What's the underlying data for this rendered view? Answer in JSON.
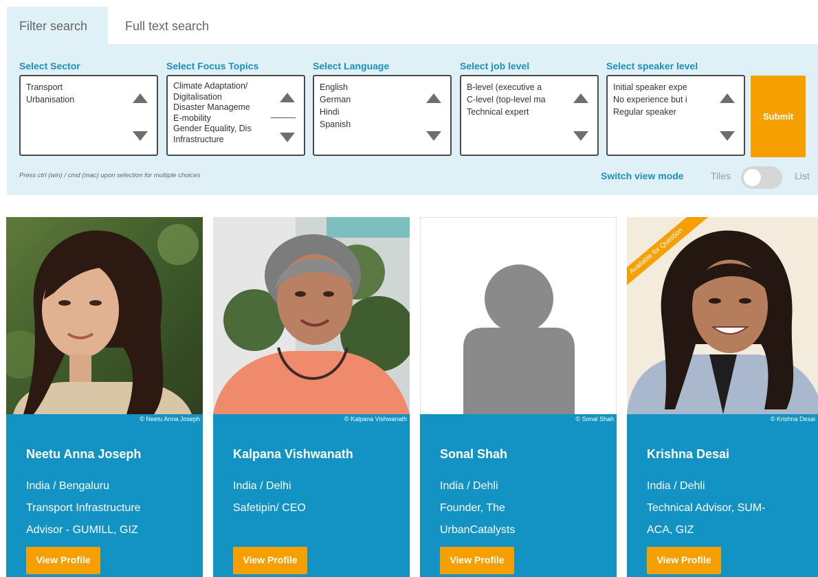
{
  "tabs": [
    {
      "label": "Filter search"
    },
    {
      "label": "Full text search"
    }
  ],
  "filters": [
    {
      "label": "Select Sector",
      "options": [
        "Transport",
        "Urbanisation"
      ]
    },
    {
      "label": "Select Focus Topics",
      "options": [
        "Climate Adaptation/",
        "Digitalisation",
        "Disaster Manageme",
        "E-mobility",
        "Gender Equality, Dis",
        "Infrastructure"
      ]
    },
    {
      "label": "Select Language",
      "options": [
        "English",
        "German",
        "Hindi",
        "Spanish"
      ]
    },
    {
      "label": "Select job level",
      "options": [
        "B-level (executive a",
        "C-level (top-level ma",
        "Technical expert"
      ]
    },
    {
      "label": "Select speaker level",
      "options": [
        "Initial speaker expe",
        "No experience but i",
        "Regular speaker"
      ]
    }
  ],
  "submit_label": "Submit",
  "hint": "Press ctrl (win) / cmd (mac) upon selection for multiple choices",
  "view_mode": {
    "label": "Switch view mode",
    "tiles": "Tiles",
    "list": "List"
  },
  "colors": {
    "accent": "#1392c4",
    "panel": "#dff0f7",
    "button": "#f5a000"
  },
  "speakers": [
    {
      "credit": "© Neetu Anna Joseph",
      "name": "Neetu Anna Joseph",
      "lines": [
        "India / Bengaluru",
        "Transport Infrastructure",
        "Advisor - GUMILL, GIZ"
      ],
      "button": "View Profile"
    },
    {
      "credit": "© Kalpana Vishwanath",
      "name": "Kalpana Vishwanath",
      "lines": [
        "India / Delhi",
        "Safetipin/ CEO"
      ],
      "button": "View Profile"
    },
    {
      "credit": "© Sonal Shah",
      "name": "Sonal Shah",
      "lines": [
        "India / Dehli",
        "Founder, The",
        "UrbanCatalysts"
      ],
      "button": "View Profile"
    },
    {
      "credit": "© Krishna Desai",
      "name": "Krishna Desai",
      "lines": [
        "India / Dehli",
        "Technical Advisor, SUM-",
        "ACA, GIZ"
      ],
      "button": "View Profile",
      "ribbon": "Available for Question"
    }
  ]
}
